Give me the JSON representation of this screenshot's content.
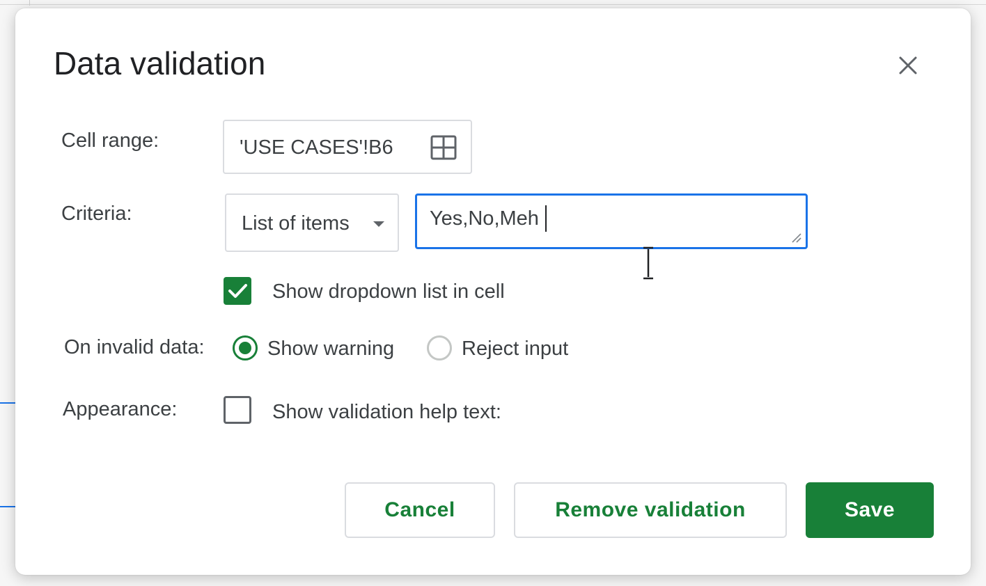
{
  "dialog": {
    "title": "Data validation",
    "close_icon": "close-icon"
  },
  "cell_range": {
    "label": "Cell range:",
    "value": "'USE CASES'!B6",
    "icon": "grid-select-icon"
  },
  "criteria": {
    "label": "Criteria:",
    "type": "List of items",
    "items_value": "Yes,No,Meh"
  },
  "dropdown_option": {
    "label": "Show dropdown list in cell",
    "checked": true
  },
  "invalid_data": {
    "label": "On invalid data:",
    "options": [
      {
        "label": "Show warning",
        "selected": true
      },
      {
        "label": "Reject input",
        "selected": false
      }
    ]
  },
  "appearance": {
    "label": "Appearance:",
    "help_text_option": "Show validation help text:",
    "checked": false
  },
  "buttons": {
    "cancel": "Cancel",
    "remove": "Remove validation",
    "save": "Save"
  },
  "colors": {
    "accent_green": "#188038",
    "focus_blue": "#1a73e8"
  }
}
